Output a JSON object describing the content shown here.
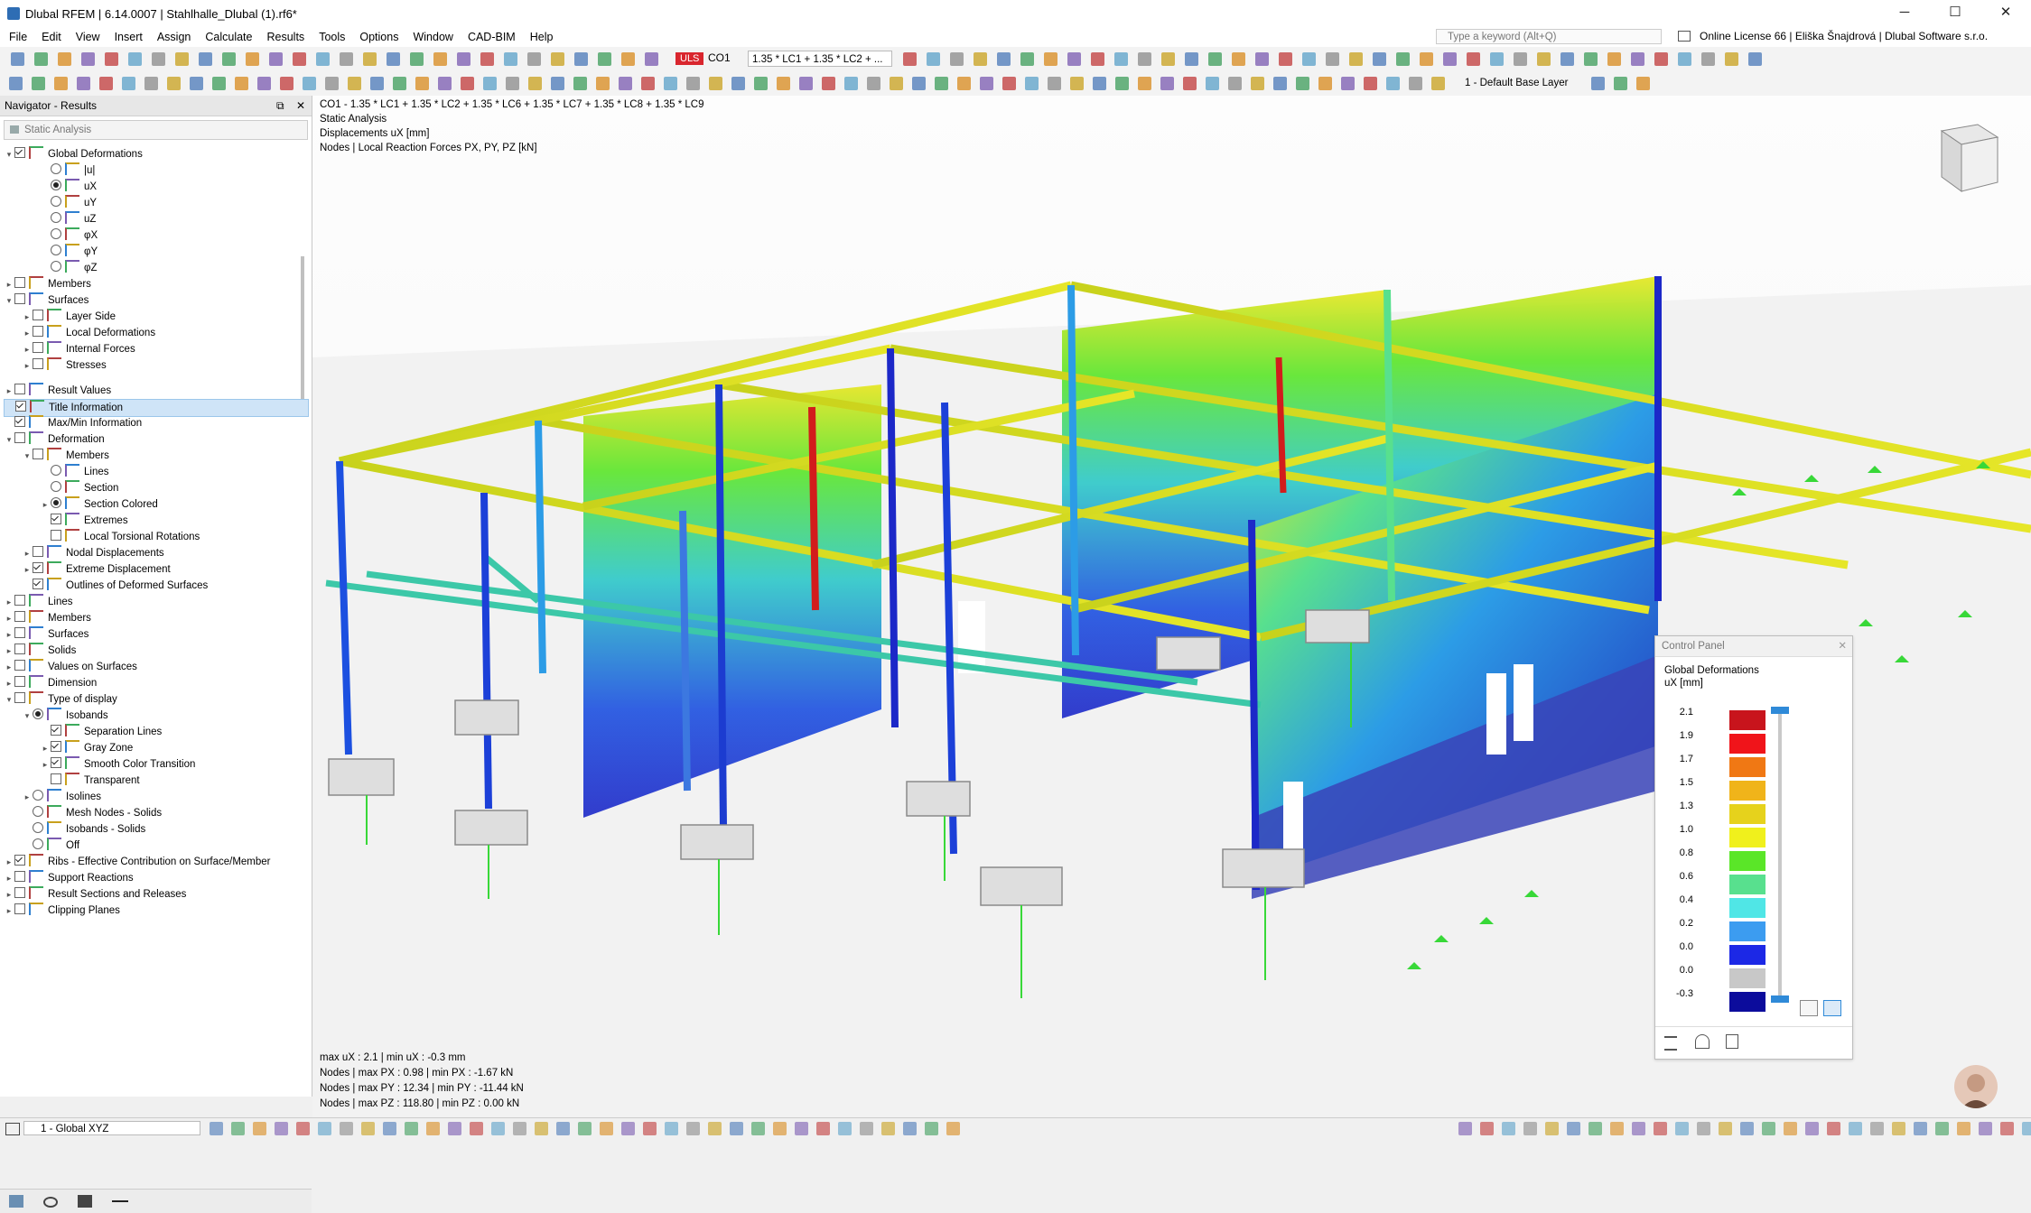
{
  "window": {
    "title": "Dlubal RFEM | 6.14.0007 | Stahlhalle_Dlubal (1).rf6*",
    "minimize": "─",
    "maximize": "☐",
    "close": "✕"
  },
  "menu": {
    "items": [
      "File",
      "Edit",
      "View",
      "Insert",
      "Assign",
      "Calculate",
      "Results",
      "Tools",
      "Options",
      "Window",
      "CAD-BIM",
      "Help"
    ],
    "search_placeholder": "Type a keyword (Alt+Q)",
    "license": "Online License 66 | Eliška Šnajdrová | Dlubal Software s.r.o."
  },
  "toolbar": {
    "design_situation": "ULS",
    "load_combo": "CO1",
    "load_combo_formula": "1.35 * LC1 + 1.35 * LC2 + ...",
    "layer": "1 - Default Base Layer"
  },
  "navigator": {
    "title": "Navigator - Results",
    "combo": "Static Analysis",
    "items": [
      {
        "label": "Global Deformations",
        "indent": 0,
        "toggle": "v",
        "check": "checked"
      },
      {
        "label": "|u|",
        "indent": 2,
        "toggle": "",
        "radio": "off"
      },
      {
        "label": "uX",
        "indent": 2,
        "toggle": "",
        "radio": "on"
      },
      {
        "label": "uY",
        "indent": 2,
        "toggle": "",
        "radio": "off"
      },
      {
        "label": "uZ",
        "indent": 2,
        "toggle": "",
        "radio": "off"
      },
      {
        "label": "φX",
        "indent": 2,
        "toggle": "",
        "radio": "off"
      },
      {
        "label": "φY",
        "indent": 2,
        "toggle": "",
        "radio": "off"
      },
      {
        "label": "φZ",
        "indent": 2,
        "toggle": "",
        "radio": "off"
      },
      {
        "label": "Members",
        "indent": 0,
        "toggle": ">",
        "check": "unchecked"
      },
      {
        "label": "Surfaces",
        "indent": 0,
        "toggle": "v",
        "check": "unchecked"
      },
      {
        "label": "Layer Side",
        "indent": 1,
        "toggle": ">",
        "check": "unchecked"
      },
      {
        "label": "Local Deformations",
        "indent": 1,
        "toggle": ">",
        "check": "unchecked"
      },
      {
        "label": "Internal Forces",
        "indent": 1,
        "toggle": ">",
        "check": "unchecked"
      },
      {
        "label": "Stresses",
        "indent": 1,
        "toggle": ">",
        "check": "unchecked"
      },
      {
        "label": "Result Values",
        "indent": 0,
        "toggle": ">",
        "check": "unchecked"
      },
      {
        "label": "Title Information",
        "indent": 0,
        "toggle": "",
        "check": "checked",
        "selected": true
      },
      {
        "label": "Max/Min Information",
        "indent": 0,
        "toggle": "",
        "check": "checked"
      },
      {
        "label": "Deformation",
        "indent": 0,
        "toggle": "v",
        "check": "unchecked"
      },
      {
        "label": "Members",
        "indent": 1,
        "toggle": "v",
        "check": "unchecked"
      },
      {
        "label": "Lines",
        "indent": 2,
        "toggle": "",
        "radio": "off"
      },
      {
        "label": "Section",
        "indent": 2,
        "toggle": "",
        "radio": "off"
      },
      {
        "label": "Section Colored",
        "indent": 2,
        "toggle": ">",
        "radio": "on"
      },
      {
        "label": "Extremes",
        "indent": 2,
        "toggle": "",
        "check": "checked"
      },
      {
        "label": "Local Torsional Rotations",
        "indent": 2,
        "toggle": "",
        "check": "unchecked"
      },
      {
        "label": "Nodal Displacements",
        "indent": 1,
        "toggle": ">",
        "check": "unchecked"
      },
      {
        "label": "Extreme Displacement",
        "indent": 1,
        "toggle": ">",
        "check": "checked"
      },
      {
        "label": "Outlines of Deformed Surfaces",
        "indent": 1,
        "toggle": "",
        "check": "checked"
      },
      {
        "label": "Lines",
        "indent": 0,
        "toggle": ">",
        "check": "unchecked"
      },
      {
        "label": "Members",
        "indent": 0,
        "toggle": ">",
        "check": "unchecked"
      },
      {
        "label": "Surfaces",
        "indent": 0,
        "toggle": ">",
        "check": "unchecked"
      },
      {
        "label": "Solids",
        "indent": 0,
        "toggle": ">",
        "check": "unchecked"
      },
      {
        "label": "Values on Surfaces",
        "indent": 0,
        "toggle": ">",
        "check": "unchecked"
      },
      {
        "label": "Dimension",
        "indent": 0,
        "toggle": ">",
        "check": "unchecked"
      },
      {
        "label": "Type of display",
        "indent": 0,
        "toggle": "v",
        "check": "unchecked"
      },
      {
        "label": "Isobands",
        "indent": 1,
        "toggle": "v",
        "radio": "on"
      },
      {
        "label": "Separation Lines",
        "indent": 2,
        "toggle": "",
        "check": "checked"
      },
      {
        "label": "Gray Zone",
        "indent": 2,
        "toggle": ">",
        "check": "checked"
      },
      {
        "label": "Smooth Color Transition",
        "indent": 2,
        "toggle": ">",
        "check": "checked"
      },
      {
        "label": "Transparent",
        "indent": 2,
        "toggle": "",
        "check": "unchecked"
      },
      {
        "label": "Isolines",
        "indent": 1,
        "toggle": ">",
        "radio": "off"
      },
      {
        "label": "Mesh Nodes - Solids",
        "indent": 1,
        "toggle": "",
        "radio": "off"
      },
      {
        "label": "Isobands - Solids",
        "indent": 1,
        "toggle": "",
        "radio": "off"
      },
      {
        "label": "Off",
        "indent": 1,
        "toggle": "",
        "radio": "off"
      },
      {
        "label": "Ribs - Effective Contribution on Surface/Member",
        "indent": 0,
        "toggle": ">",
        "check": "checked"
      },
      {
        "label": "Support Reactions",
        "indent": 0,
        "toggle": ">",
        "check": "unchecked"
      },
      {
        "label": "Result Sections and Releases",
        "indent": 0,
        "toggle": ">",
        "check": "unchecked"
      },
      {
        "label": "Clipping Planes",
        "indent": 0,
        "toggle": ">",
        "check": "unchecked"
      }
    ]
  },
  "viewport": {
    "info_lines": [
      "CO1 - 1.35 * LC1 + 1.35 * LC2 + 1.35 * LC6 + 1.35 * LC7 + 1.35 * LC8 + 1.35 * LC9",
      "Static Analysis",
      "Displacements uX [mm]",
      "Nodes | Local Reaction Forces PX, PY, PZ [kN]"
    ],
    "summary_lines": [
      "max uX : 2.1 | min uX : -0.3 mm",
      "Nodes | max PX : 0.98 | min PX : -1.67 kN",
      "Nodes | max PY : 12.34 | min PY : -11.44 kN",
      "Nodes | max PZ : 118.80 | min PZ : 0.00 kN"
    ]
  },
  "control_panel": {
    "title": "Control Panel",
    "close": "✕",
    "result": "Global Deformations",
    "unit": "uX [mm]",
    "legend": [
      {
        "value": "2.1",
        "color": "#c8141c"
      },
      {
        "value": "1.9",
        "color": "#f0141a"
      },
      {
        "value": "1.7",
        "color": "#f07814"
      },
      {
        "value": "1.5",
        "color": "#f0b41a"
      },
      {
        "value": "1.3",
        "color": "#e6d21c"
      },
      {
        "value": "1.0",
        "color": "#f0f01c"
      },
      {
        "value": "0.8",
        "color": "#5ae628"
      },
      {
        "value": "0.6",
        "color": "#58e08e"
      },
      {
        "value": "0.4",
        "color": "#50e6e6"
      },
      {
        "value": "0.2",
        "color": "#3c9cf0"
      },
      {
        "value": "0.0",
        "color": "#1c28e6"
      },
      {
        "value": "0.0",
        "color": "#c8c8c8"
      },
      {
        "value": "-0.3",
        "color": "#0c0c9c"
      }
    ]
  },
  "statusbar": {
    "view": "1 - Global XYZ"
  }
}
